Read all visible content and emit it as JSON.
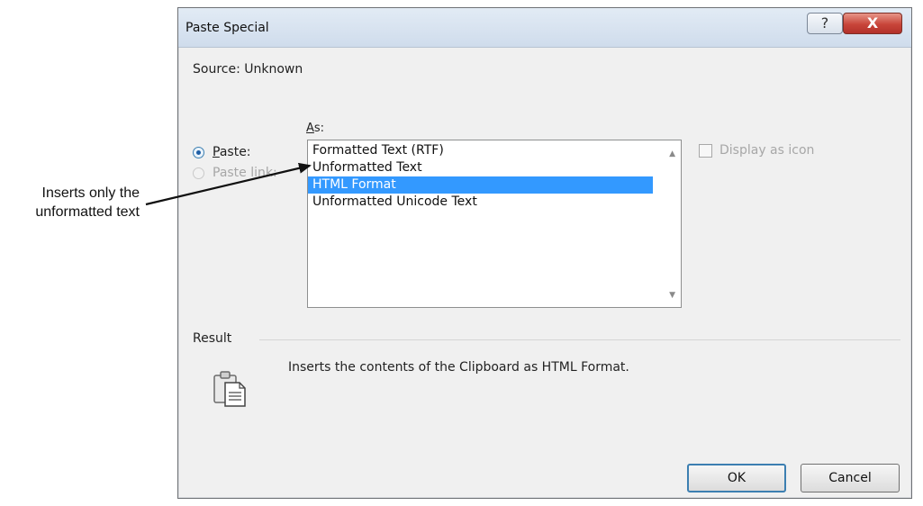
{
  "callout": {
    "line1": "Inserts only the",
    "line2": "unformatted text"
  },
  "dialog": {
    "title": "Paste Special",
    "help_glyph": "?",
    "close_glyph": "X",
    "source": "Source:  Unknown",
    "as_label_underlined": "A",
    "as_label_rest": "s:",
    "paste_options": [
      {
        "underlined": "P",
        "rest": "aste:",
        "selected": true,
        "enabled": true
      },
      {
        "underlined": "",
        "rest": "Paste link:",
        "selected": false,
        "enabled": false
      }
    ],
    "formats": [
      {
        "label": "Formatted Text (RTF)",
        "selected": false
      },
      {
        "label": "Unformatted Text",
        "selected": false
      },
      {
        "label": "HTML Format",
        "selected": true
      },
      {
        "label": "Unformatted Unicode Text",
        "selected": false
      }
    ],
    "display_as_icon": {
      "label": "Display as icon",
      "checked": false,
      "enabled": false
    },
    "result_label": "Result",
    "result_text": "Inserts the contents of the Clipboard as HTML Format.",
    "ok_label": "OK",
    "cancel_label": "Cancel"
  },
  "colors": {
    "selection": "#3399ff",
    "close_button": "#c8453a",
    "default_button_border": "#3c7fb1"
  },
  "icons": {
    "result_icon": "clipboard-paste-icon"
  }
}
